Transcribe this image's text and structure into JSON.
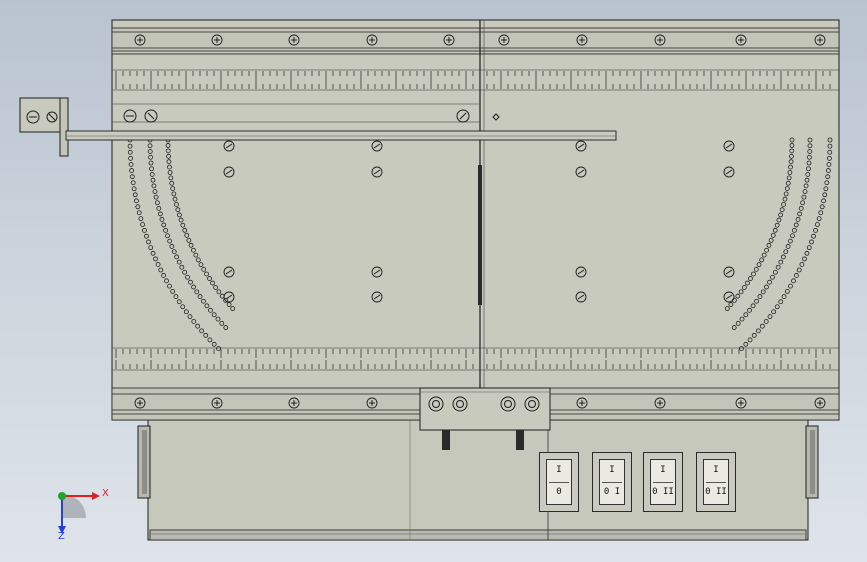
{
  "viewport": {
    "background_top": "#b9c3cf",
    "background_bottom": "#dfe4ea"
  },
  "model": {
    "plate_color": "#c8cabe",
    "base_color": "#c6c8bc",
    "line_color": "#1e1e1e",
    "switches": [
      {
        "top_label": "I",
        "bottom_label": "0"
      },
      {
        "top_label": "I",
        "bottom_label": "0 I"
      },
      {
        "top_label": "I",
        "bottom_label": "0 II"
      },
      {
        "top_label": "I",
        "bottom_label": "0 II"
      }
    ]
  },
  "triad": {
    "x_label": "X",
    "z_label": "Z",
    "x_color": "#e0201c",
    "y_color": "#1fa52a",
    "z_color": "#2740d6"
  }
}
